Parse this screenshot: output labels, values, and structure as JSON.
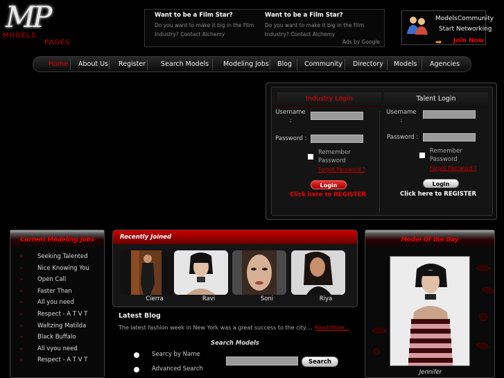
{
  "logo": {
    "monogram": "MP",
    "word1": "MODELS",
    "word2": "PAGES"
  },
  "ads": {
    "items": [
      {
        "title": "Want to be a Film Star?",
        "text": "Do you want to make it big in the Film Industry? Contact Alchemy"
      },
      {
        "title": "Want to be a Film Star?",
        "text": "Do you want to make it big in the Film Industry? Contact Alchemy"
      }
    ],
    "attribution": "Ads by Google"
  },
  "promo": {
    "line1a": "Models",
    "line1b": "Community",
    "line2a": "Start",
    "line2b": "Networking",
    "join": "Join Now"
  },
  "nav": [
    "Home",
    "About Us",
    "Register",
    "Search Models",
    "Modeling Jobs",
    "Blog",
    "Community",
    "Directory",
    "Models",
    "Agencies"
  ],
  "login": {
    "industry": {
      "title": "Industry Login",
      "username_label": "Username :",
      "password_label": "Password :",
      "remember": "Remember Password",
      "forgot": "Forgot Password ?",
      "button": "Login",
      "register": "Click here to REGISTER"
    },
    "talent": {
      "title": "Talent Login",
      "username_label": "Username :",
      "password_label": "Password :",
      "remember": "Remember Password",
      "forgot": "Forgot Password ?",
      "button": "Login",
      "register": "Click here to REGISTER"
    }
  },
  "jobs": {
    "title": "Current Modeling Jobs",
    "items": [
      "Seeking Talented",
      "Nice Knowing You",
      "Open Call",
      "Faster Than",
      "All you need",
      "Respect - A T V T",
      "Waltzing Matilda",
      "Black Buffalo",
      "All vyou need",
      "Respect - A T V T"
    ]
  },
  "recent": {
    "title": "Recently Joined",
    "models": [
      "Cierra",
      "Ravi",
      "Soni",
      "Riya"
    ]
  },
  "blog": {
    "title": "Latest Blog",
    "text": "The latest fashion week in New York was a great success to the city....",
    "read_more": "Read More..."
  },
  "search": {
    "title": "Search Models",
    "option1": "Searcy by Name",
    "option2": "Advanced Search",
    "button": "Search"
  },
  "model_of_day": {
    "title": "Model Of the Day",
    "name": "Jennifer"
  },
  "colors": {
    "accent_red": "#e00000",
    "background": "#000000"
  }
}
